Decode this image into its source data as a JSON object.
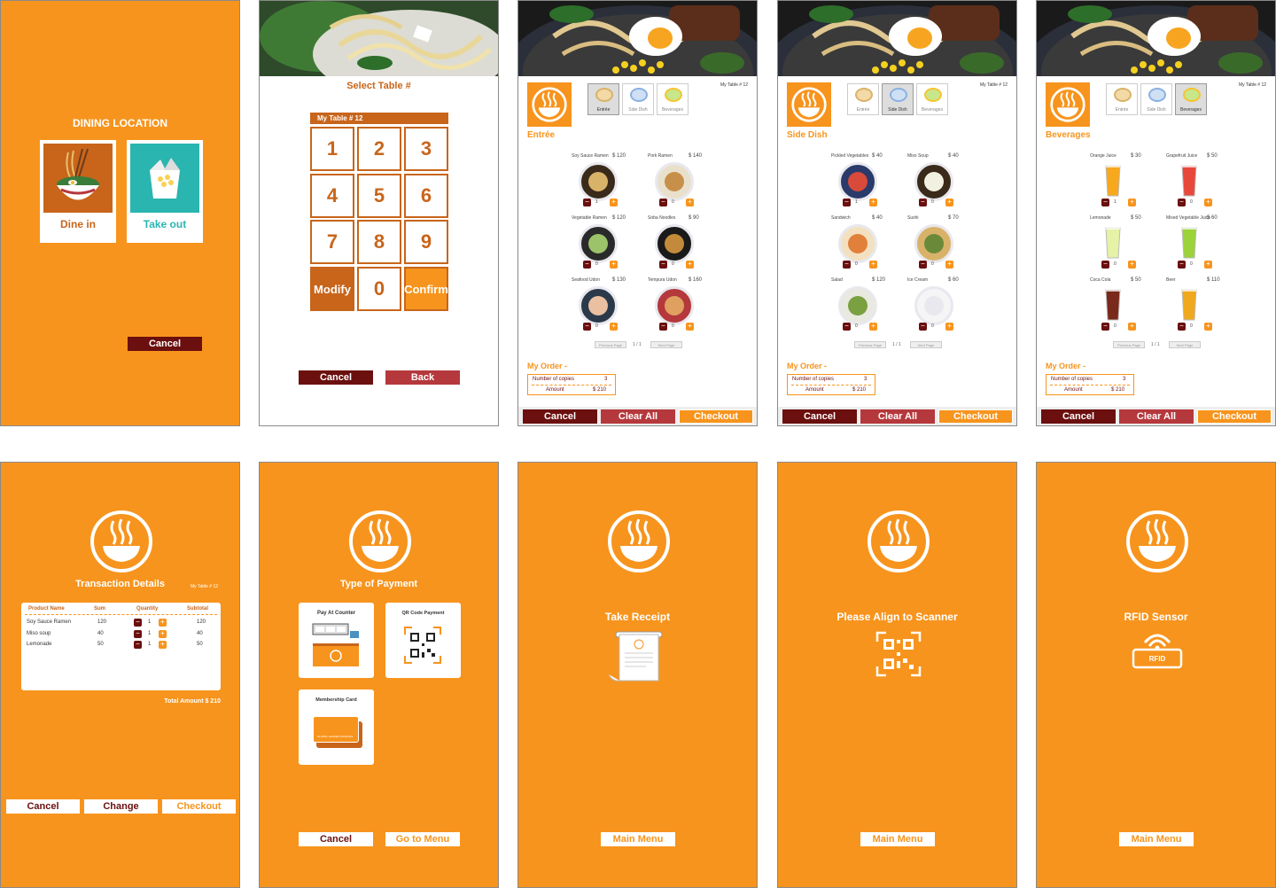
{
  "screen1": {
    "heading": "DINING LOCATION",
    "dine_in": "Dine in",
    "take_out": "Take out",
    "cancel": "Cancel"
  },
  "screen2": {
    "heading": "Select Table #",
    "table_label": "My Table #  12",
    "keys": [
      "1",
      "2",
      "3",
      "4",
      "5",
      "6",
      "7",
      "8",
      "9"
    ],
    "modify": "Modify",
    "zero": "0",
    "confirm": "Confirm",
    "cancel": "Cancel",
    "back": "Back"
  },
  "tabs": {
    "entree": "Entrée",
    "side": "Side Dish",
    "bev": "Beverages"
  },
  "my_table": "My Table #  12",
  "entree_screen": {
    "title": "Entrée",
    "items": [
      {
        "name": "Soy Sauce Ramen",
        "price": "$ 120",
        "qty": "1"
      },
      {
        "name": "Pork Ramen",
        "price": "$ 140",
        "qty": "0"
      },
      {
        "name": "Vegetable Ramen",
        "price": "$ 120",
        "qty": "0"
      },
      {
        "name": "Soba Noodles",
        "price": "$ 90",
        "qty": "0"
      },
      {
        "name": "Seafood Udon",
        "price": "$ 130",
        "qty": "0"
      },
      {
        "name": "Tempura Udon",
        "price": "$ 160",
        "qty": "0"
      }
    ]
  },
  "side_screen": {
    "title": "Side Dish",
    "items": [
      {
        "name": "Pickled Vegetables",
        "price": "$ 40",
        "qty": "1"
      },
      {
        "name": "Miso Soup",
        "price": "$ 40",
        "qty": "0"
      },
      {
        "name": "Sandwich",
        "price": "$ 40",
        "qty": "0"
      },
      {
        "name": "Sushi",
        "price": "$ 70",
        "qty": "0"
      },
      {
        "name": "Salad",
        "price": "$ 120",
        "qty": "0"
      },
      {
        "name": "Ice Cream",
        "price": "$ 60",
        "qty": "0"
      }
    ]
  },
  "bev_screen": {
    "title": "Beverages",
    "items": [
      {
        "name": "Orange Juice",
        "price": "$ 30",
        "qty": "1"
      },
      {
        "name": "Grapefruit Juice",
        "price": "$ 50",
        "qty": "0"
      },
      {
        "name": "Lemonade",
        "price": "$ 50",
        "qty": "0"
      },
      {
        "name": "Mixed Vegetable Juice",
        "price": "$ 60",
        "qty": "0"
      },
      {
        "name": "Coca Cola",
        "price": "$ 50",
        "qty": "0"
      },
      {
        "name": "Beer",
        "price": "$ 110",
        "qty": "0"
      }
    ]
  },
  "pager": {
    "prev": "Previous Page",
    "next": "Next Page",
    "num": "1 / 1"
  },
  "order": {
    "title": "My Order -",
    "copies_label": "Number of copies",
    "copies": "3",
    "amount_label": "Amount",
    "amount": "$  210"
  },
  "menu_buttons": {
    "cancel": "Cancel",
    "clear": "Clear All",
    "checkout": "Checkout"
  },
  "transaction": {
    "heading": "Transaction Details",
    "headers": [
      "Product Name",
      "Sum",
      "Quantity",
      "Subtotal"
    ],
    "rows": [
      {
        "name": "Soy Sauce Ramen",
        "sum": "120",
        "qty": "1",
        "subtotal": "120"
      },
      {
        "name": "Miso soup",
        "sum": "40",
        "qty": "1",
        "subtotal": "40"
      },
      {
        "name": "Lemonade",
        "sum": "50",
        "qty": "1",
        "subtotal": "50"
      }
    ],
    "total": "Total Amount  $    210",
    "cancel": "Cancel",
    "change": "Change",
    "checkout": "Checkout"
  },
  "payment": {
    "heading": "Type of Payment",
    "counter": "Pay At Counter",
    "qr": "QR Code Payment",
    "card": "Membership Card",
    "card_text": "GLOBAL LEADER NOODLES",
    "cancel": "Cancel",
    "menu": "Go to Menu"
  },
  "receipt": {
    "heading": "Take Receipt",
    "btn": "Main Menu"
  },
  "scanner": {
    "heading": "Please Align to Scanner",
    "btn": "Main Menu"
  },
  "rfid": {
    "heading": "RFID Sensor",
    "label": "RFID",
    "btn": "Main Menu"
  },
  "colors": {
    "orange": "#f7941d",
    "dark_red": "#6b0f0f",
    "red": "#b5383c",
    "brown": "#c8651b"
  }
}
